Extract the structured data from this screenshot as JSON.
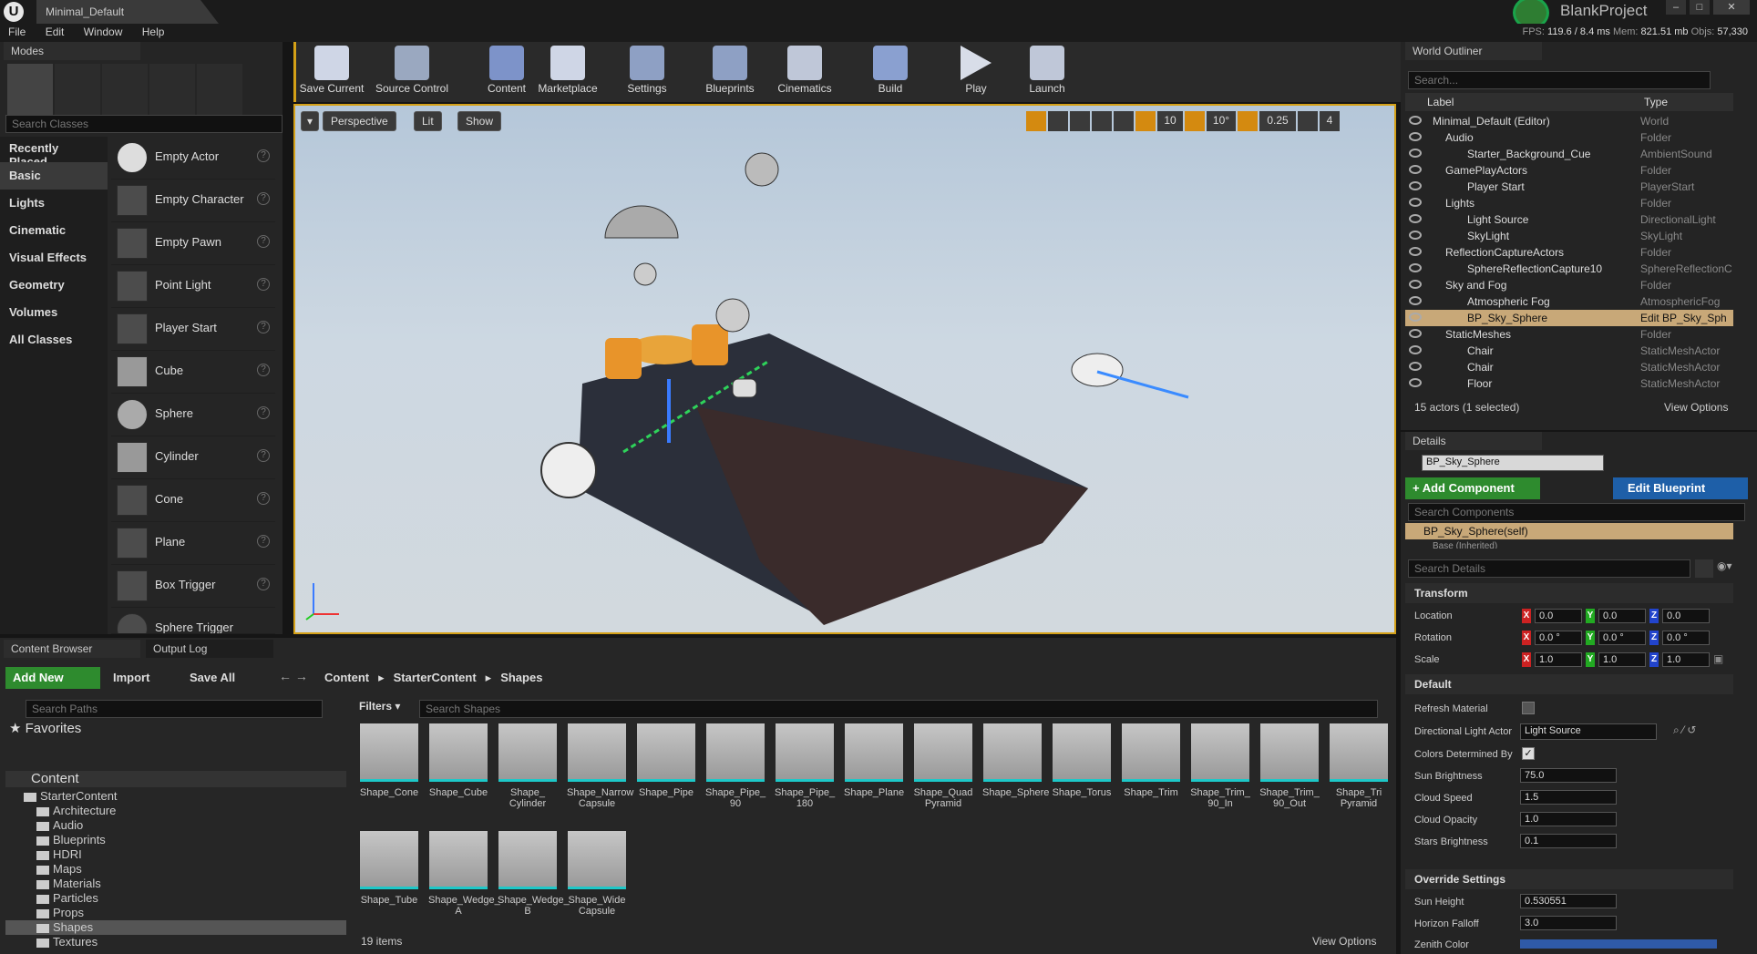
{
  "window": {
    "tab_title": "Minimal_Default",
    "project_name": "BlankProject",
    "min": "–",
    "max": "□",
    "close": "✕"
  },
  "menu": [
    "File",
    "Edit",
    "Window",
    "Help"
  ],
  "stats": {
    "fps_label": "FPS:",
    "fps": "119.6",
    "ms": "/ 8.4 ms",
    "mem_label": "Mem:",
    "mem": "821.51 mb",
    "objs_label": "Objs:",
    "objs": "57,330"
  },
  "modes": {
    "tab": "Modes",
    "search_placeholder": "Search Classes",
    "categories": [
      "Recently Placed",
      "Basic",
      "Lights",
      "Cinematic",
      "Visual Effects",
      "Geometry",
      "Volumes",
      "All Classes"
    ],
    "items": [
      "Empty Actor",
      "Empty Character",
      "Empty Pawn",
      "Point Light",
      "Player Start",
      "Cube",
      "Sphere",
      "Cylinder",
      "Cone",
      "Plane",
      "Box Trigger",
      "Sphere Trigger"
    ]
  },
  "toolbar": [
    "Save Current",
    "Source Control",
    "Content",
    "Marketplace",
    "Settings",
    "Blueprints",
    "Cinematics",
    "Build",
    "Play",
    "Launch"
  ],
  "viewport": {
    "perspective": "Perspective",
    "lit": "Lit",
    "show": "Show",
    "grid": "10",
    "angle": "10°",
    "scale": "0.25",
    "speed": "4"
  },
  "outliner": {
    "tab": "World Outliner",
    "search_placeholder": "Search...",
    "col_label": "Label",
    "col_type": "Type",
    "rows": [
      {
        "label": "Minimal_Default (Editor)",
        "type": "World"
      },
      {
        "label": "Audio",
        "type": "Folder"
      },
      {
        "label": "Starter_Background_Cue",
        "type": "AmbientSound"
      },
      {
        "label": "GamePlayActors",
        "type": "Folder"
      },
      {
        "label": "Player Start",
        "type": "PlayerStart"
      },
      {
        "label": "Lights",
        "type": "Folder"
      },
      {
        "label": "Light Source",
        "type": "DirectionalLight"
      },
      {
        "label": "SkyLight",
        "type": "SkyLight"
      },
      {
        "label": "ReflectionCaptureActors",
        "type": "Folder"
      },
      {
        "label": "SphereReflectionCapture10",
        "type": "SphereReflectionC"
      },
      {
        "label": "Sky and Fog",
        "type": "Folder"
      },
      {
        "label": "Atmospheric Fog",
        "type": "AtmosphericFog"
      },
      {
        "label": "BP_Sky_Sphere",
        "type": "Edit BP_Sky_Sph"
      },
      {
        "label": "StaticMeshes",
        "type": "Folder"
      },
      {
        "label": "Chair",
        "type": "StaticMeshActor"
      },
      {
        "label": "Chair",
        "type": "StaticMeshActor"
      },
      {
        "label": "Floor",
        "type": "StaticMeshActor"
      }
    ],
    "count": "15 actors (1 selected)",
    "view_options": "View Options"
  },
  "details": {
    "tab": "Details",
    "name": "BP_Sky_Sphere",
    "add_component": "+ Add Component",
    "edit_blueprint": "Edit Blueprint",
    "search_components": "Search Components",
    "self": "BP_Sky_Sphere(self)",
    "inherited": "Base (Inherited)",
    "search_details": "Search Details",
    "transform": "Transform",
    "location": "Location",
    "rotation": "Rotation",
    "scale": "Scale",
    "loc": [
      "0.0",
      "0.0",
      "0.0"
    ],
    "rot": [
      "0.0 °",
      "0.0 °",
      "0.0 °"
    ],
    "scl": [
      "1.0",
      "1.0",
      "1.0"
    ],
    "default": "Default",
    "refresh_material": "Refresh Material",
    "directional_light_actor": "Directional Light Actor",
    "light_source": "Light Source",
    "colors_determined": "Colors Determined By",
    "sun_brightness": "Sun Brightness",
    "sun_brightness_val": "75.0",
    "cloud_speed": "Cloud Speed",
    "cloud_speed_val": "1.5",
    "cloud_opacity": "Cloud Opacity",
    "cloud_opacity_val": "1.0",
    "stars_brightness": "Stars Brightness",
    "stars_brightness_val": "0.1",
    "override": "Override Settings",
    "sun_height": "Sun Height",
    "sun_height_val": "0.530551",
    "horizon_falloff": "Horizon Falloff",
    "horizon_falloff_val": "3.0",
    "zenith_color": "Zenith Color"
  },
  "content_browser": {
    "tab": "Content Browser",
    "output_tab": "Output Log",
    "add_new": "Add New",
    "import": "Import",
    "save_all": "Save All",
    "path": [
      "Content",
      "StarterContent",
      "Shapes"
    ],
    "search_paths": "Search Paths",
    "favorites": "Favorites",
    "filters": "Filters",
    "search_shapes": "Search Shapes",
    "tree": [
      "Content",
      "StarterContent",
      "Architecture",
      "Audio",
      "Blueprints",
      "HDRI",
      "Maps",
      "Materials",
      "Particles",
      "Props",
      "Shapes",
      "Textures"
    ],
    "assets": [
      "Shape_Cone",
      "Shape_Cube",
      "Shape_ Cylinder",
      "Shape_Narrow Capsule",
      "Shape_Pipe",
      "Shape_Pipe_ 90",
      "Shape_Pipe_ 180",
      "Shape_Plane",
      "Shape_Quad Pyramid",
      "Shape_Sphere",
      "Shape_Torus",
      "Shape_Trim",
      "Shape_Trim_ 90_In",
      "Shape_Trim_ 90_Out",
      "Shape_Tri Pyramid",
      "Shape_Tube",
      "Shape_Wedge_ A",
      "Shape_Wedge_ B",
      "Shape_Wide Capsule"
    ],
    "items_count": "19 items",
    "view_options": "View Options"
  }
}
